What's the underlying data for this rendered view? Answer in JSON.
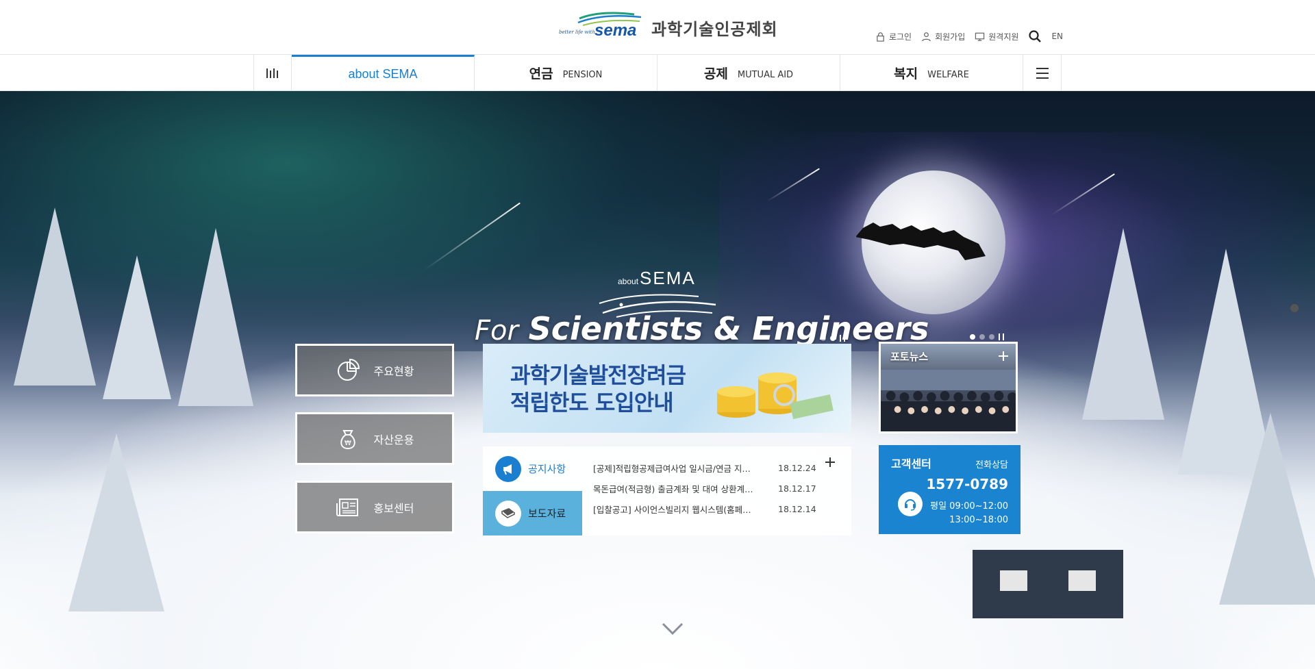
{
  "header": {
    "logo_tagline": "better life with",
    "logo_brand": "sema",
    "logo_title": "과학기술인공제회",
    "util": {
      "login": "로그인",
      "join": "회원가입",
      "remote": "원격지원",
      "lang": "EN"
    }
  },
  "gnb": {
    "about": "about  SEMA",
    "tabs": [
      {
        "ko": "연금",
        "en": "PENSION"
      },
      {
        "ko": "공제",
        "en": "MUTUAL AID"
      },
      {
        "ko": "복지",
        "en": "WELFARE"
      }
    ]
  },
  "hero": {
    "about_small": "about",
    "about_big": "SEMA",
    "tagline_for": "For",
    "tagline_rest": "Scientists & Engineers"
  },
  "quick_links": [
    {
      "label": "주요현황",
      "icon": "pie-chart-icon"
    },
    {
      "label": "자산운용",
      "icon": "money-bag-icon"
    },
    {
      "label": "홍보센터",
      "icon": "newspaper-icon"
    }
  ],
  "banner": {
    "line1": "과학기술발전장려금",
    "line2": "적립한도 도입안내"
  },
  "news": {
    "tab_notice": "공지사항",
    "tab_press": "보도자료",
    "items": [
      {
        "title": "[공제]적립형공제급여사업 일시금/연금 지급방식 변경 안내",
        "date": "18.12.24"
      },
      {
        "title": "목돈급여(적금형) 출금계좌 및 대여 상환계좌 변경 안내",
        "date": "18.12.17"
      },
      {
        "title": "[입찰공고] 사이언스빌리지 웹시스템(홈페이지) 구축 사업",
        "date": "18.12.14"
      }
    ]
  },
  "photo_news": {
    "title": "포토뉴스"
  },
  "customer_center": {
    "title": "고객센터",
    "sub": "전화상담",
    "phone": "1577-0789",
    "hours1": "평일 09:00~12:00",
    "hours2": "13:00~18:00"
  },
  "colors": {
    "accent": "#1a7fd0",
    "cs_bg": "#1a84d0"
  }
}
